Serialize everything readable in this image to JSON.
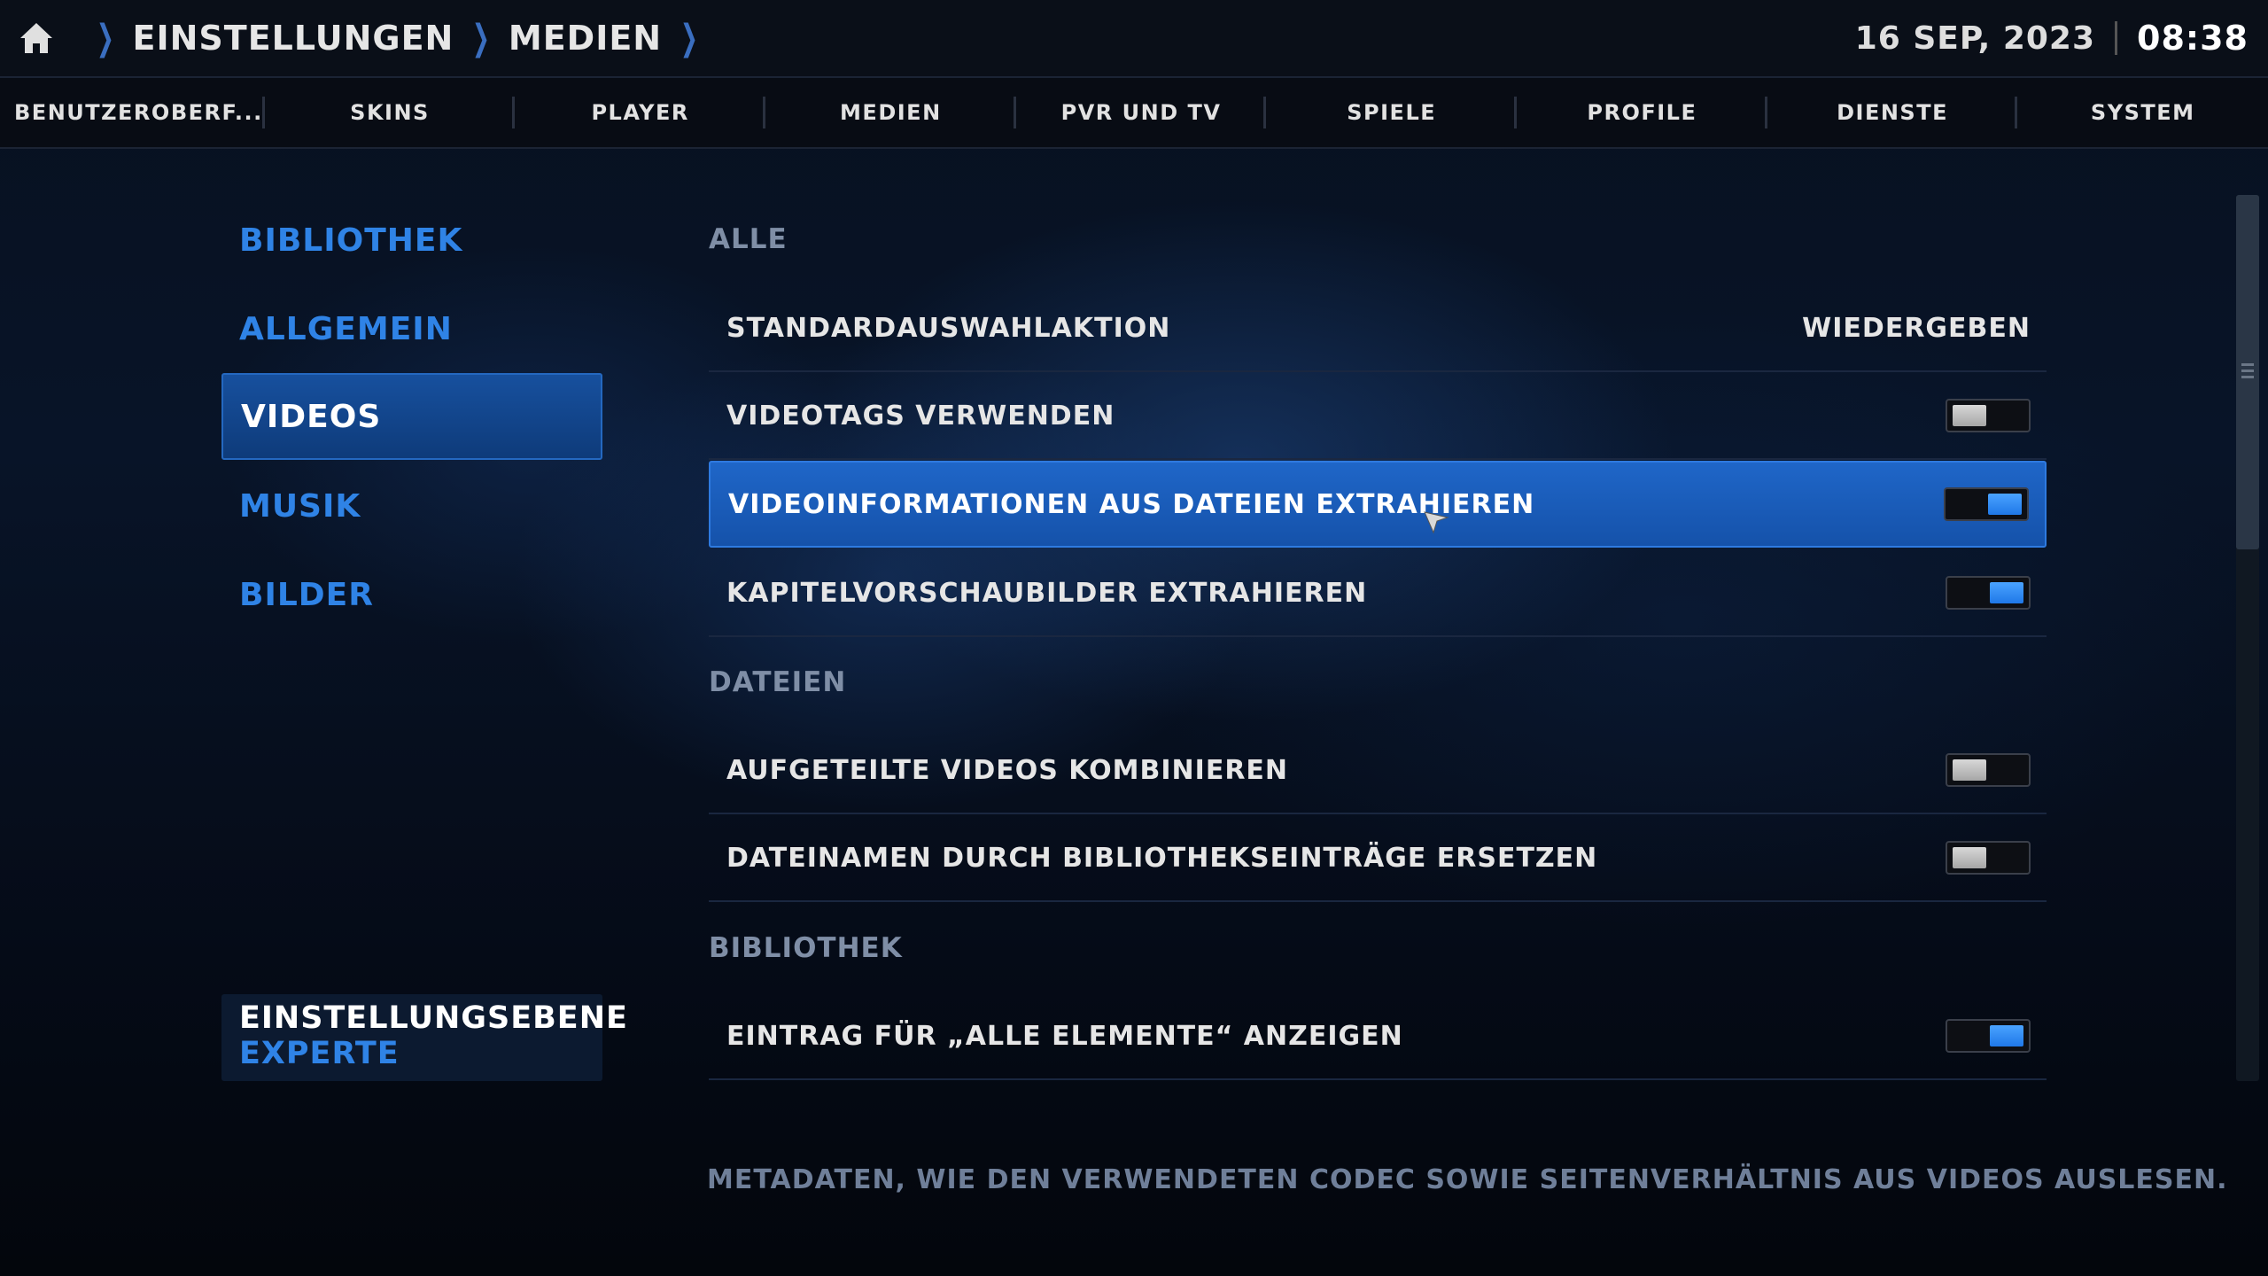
{
  "header": {
    "breadcrumbs": [
      "EINSTELLUNGEN",
      "MEDIEN"
    ],
    "date": "16 SEP, 2023",
    "time": "08:38"
  },
  "tabs": [
    "BENUTZEROBERF...",
    "SKINS",
    "PLAYER",
    "MEDIEN",
    "PVR UND TV",
    "SPIELE",
    "PROFILE",
    "DIENSTE",
    "SYSTEM"
  ],
  "sidebar": {
    "items": [
      {
        "label": "BIBLIOTHEK",
        "active": false
      },
      {
        "label": "ALLGEMEIN",
        "active": false
      },
      {
        "label": "VIDEOS",
        "active": true
      },
      {
        "label": "MUSIK",
        "active": false
      },
      {
        "label": "BILDER",
        "active": false
      }
    ],
    "level": {
      "title": "EINSTELLUNGSEBENE",
      "value": "EXPERTE"
    }
  },
  "sections": [
    {
      "title": "ALLE",
      "rows": [
        {
          "label": "STANDARDAUSWAHLAKTION",
          "type": "value",
          "value": "WIEDERGEBEN"
        },
        {
          "label": "VIDEOTAGS VERWENDEN",
          "type": "toggle",
          "on": false
        },
        {
          "label": "VIDEOINFORMATIONEN AUS DATEIEN EXTRAHIEREN",
          "type": "toggle",
          "on": true,
          "focused": true
        },
        {
          "label": "KAPITELVORSCHAUBILDER EXTRAHIEREN",
          "type": "toggle",
          "on": true
        }
      ]
    },
    {
      "title": "DATEIEN",
      "rows": [
        {
          "label": "AUFGETEILTE VIDEOS KOMBINIEREN",
          "type": "toggle",
          "on": false
        },
        {
          "label": "DATEINAMEN DURCH BIBLIOTHEKSEINTRÄGE ERSETZEN",
          "type": "toggle",
          "on": false
        }
      ]
    },
    {
      "title": "BIBLIOTHEK",
      "rows": [
        {
          "label": "EINTRAG FÜR „ALLE ELEMENTE“ ANZEIGEN",
          "type": "toggle",
          "on": true
        }
      ]
    }
  ],
  "description": "METADATEN, WIE DEN VERWENDETEN CODEC SOWIE SEITENVERHÄLTNIS AUS VIDEOS AUSLESEN.",
  "colors": {
    "accent": "#2f83e6",
    "focus": "#1f66c8",
    "toggle_on": "#2b8cf5"
  },
  "icons": [
    "home-icon",
    "chevron-right-icon",
    "mouse-pointer-icon"
  ]
}
